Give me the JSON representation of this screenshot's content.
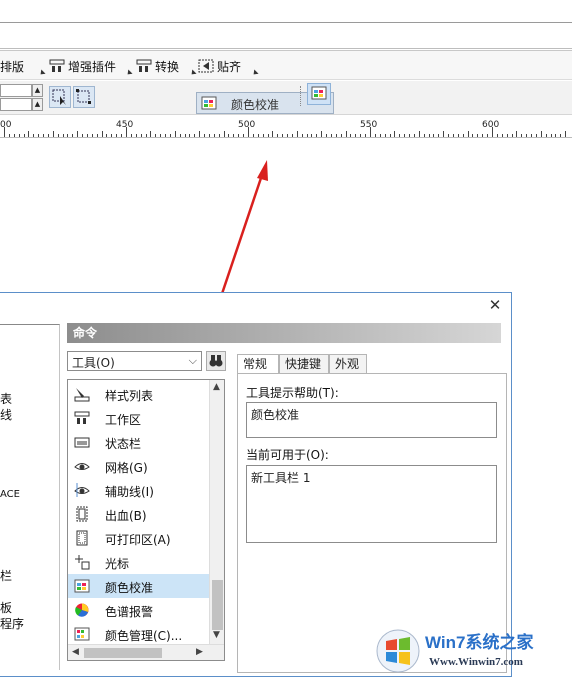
{
  "menu": {
    "items": [
      {
        "label": "排版",
        "icon": "layout-icon"
      },
      {
        "label": "增强插件",
        "icon": "plugin-icon"
      },
      {
        "label": "转换",
        "icon": "convert-icon"
      },
      {
        "label": "贴齐",
        "icon": "snap-icon"
      }
    ]
  },
  "floating_toolbar": {
    "label": "颜色校准"
  },
  "ruler": {
    "labels": [
      "00",
      "450",
      "500",
      "550",
      "600"
    ]
  },
  "dialog": {
    "left_panel": [
      "表",
      "线",
      "ACE",
      "栏",
      "板",
      "程序"
    ],
    "commands_header": "命令",
    "category_select": "工具(O)",
    "list_items": [
      {
        "label": "样式列表",
        "icon": "style-list-icon"
      },
      {
        "label": "工作区",
        "icon": "workspace-icon"
      },
      {
        "label": "状态栏",
        "icon": "status-bar-icon"
      },
      {
        "label": "网格(G)",
        "icon": "grid-eye-icon"
      },
      {
        "label": "辅助线(I)",
        "icon": "guideline-eye-icon"
      },
      {
        "label": "出血(B)",
        "icon": "bleed-icon"
      },
      {
        "label": "可打印区(A)",
        "icon": "printable-area-icon"
      },
      {
        "label": "光标",
        "icon": "cursor-icon"
      },
      {
        "label": "颜色校准",
        "icon": "color-calibration-icon",
        "selected": true
      },
      {
        "label": "色谱报警",
        "icon": "gamut-alarm-icon"
      },
      {
        "label": "颜色管理(C)...",
        "icon": "color-management-icon"
      }
    ],
    "tabs": [
      "常规",
      "快捷键",
      "外观"
    ],
    "active_tab": "常规",
    "tooltip_help_label": "工具提示帮助(T):",
    "tooltip_help_value": "颜色校准",
    "available_label": "当前可用于(O):",
    "available_value": "新工具栏 1"
  },
  "watermark": {
    "brand": "Win7系统之家",
    "url": "Www.Winwin7.com"
  },
  "colors": {
    "arrow": "#d9201e",
    "selection": "#cce4f7",
    "dialog_border": "#5b8fc9"
  }
}
